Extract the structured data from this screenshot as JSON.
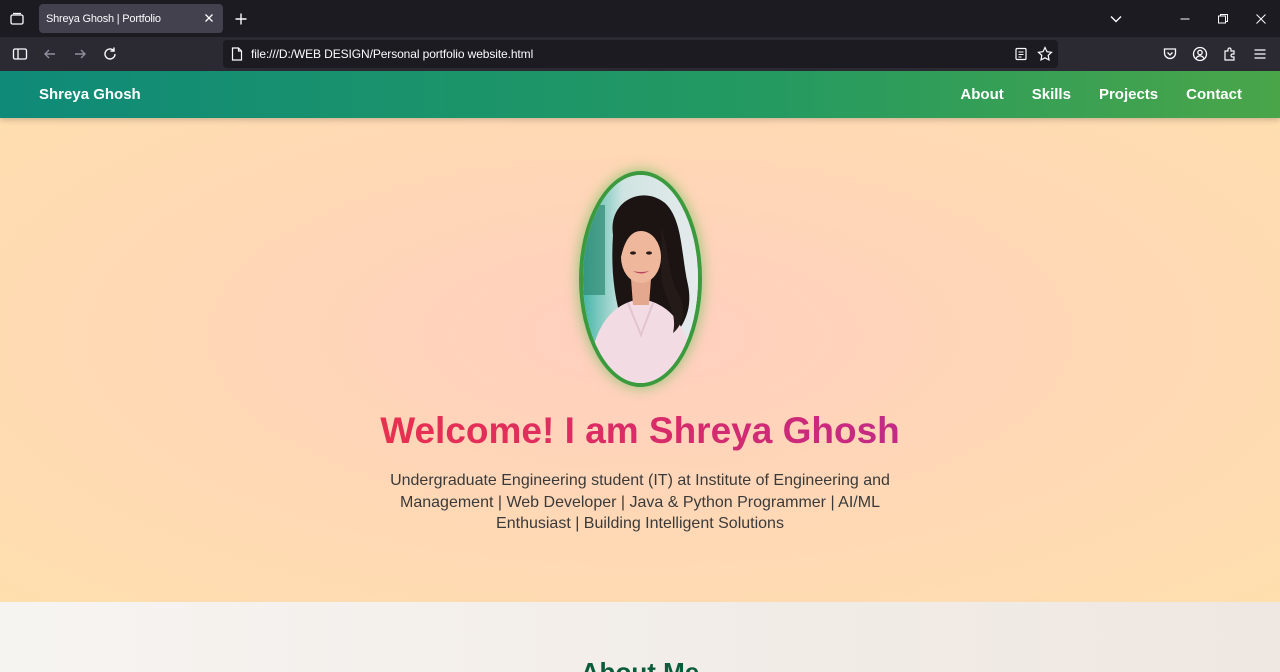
{
  "browser": {
    "tab_title": "Shreya Ghosh | Portfolio",
    "url": "file:///D:/WEB DESIGN/Personal portfolio website.html"
  },
  "site": {
    "brand": "Shreya Ghosh",
    "nav": [
      "About",
      "Skills",
      "Projects",
      "Contact"
    ]
  },
  "hero": {
    "title": "Welcome! I am Shreya Ghosh",
    "subtitle": "Undergraduate Engineering student (IT) at Institute of Engineering and Management | Web Developer | Java & Python Programmer | AI/ML Enthusiast | Building Intelligent Solutions"
  },
  "about": {
    "title": "About Me"
  },
  "colors": {
    "header_gradient": [
      "#0f8a78",
      "#4aa549"
    ],
    "title_gradient": [
      "#e8304f",
      "#c22a86"
    ],
    "portrait_border": "#3c9a3e",
    "about_title": "#0b5c3b"
  }
}
